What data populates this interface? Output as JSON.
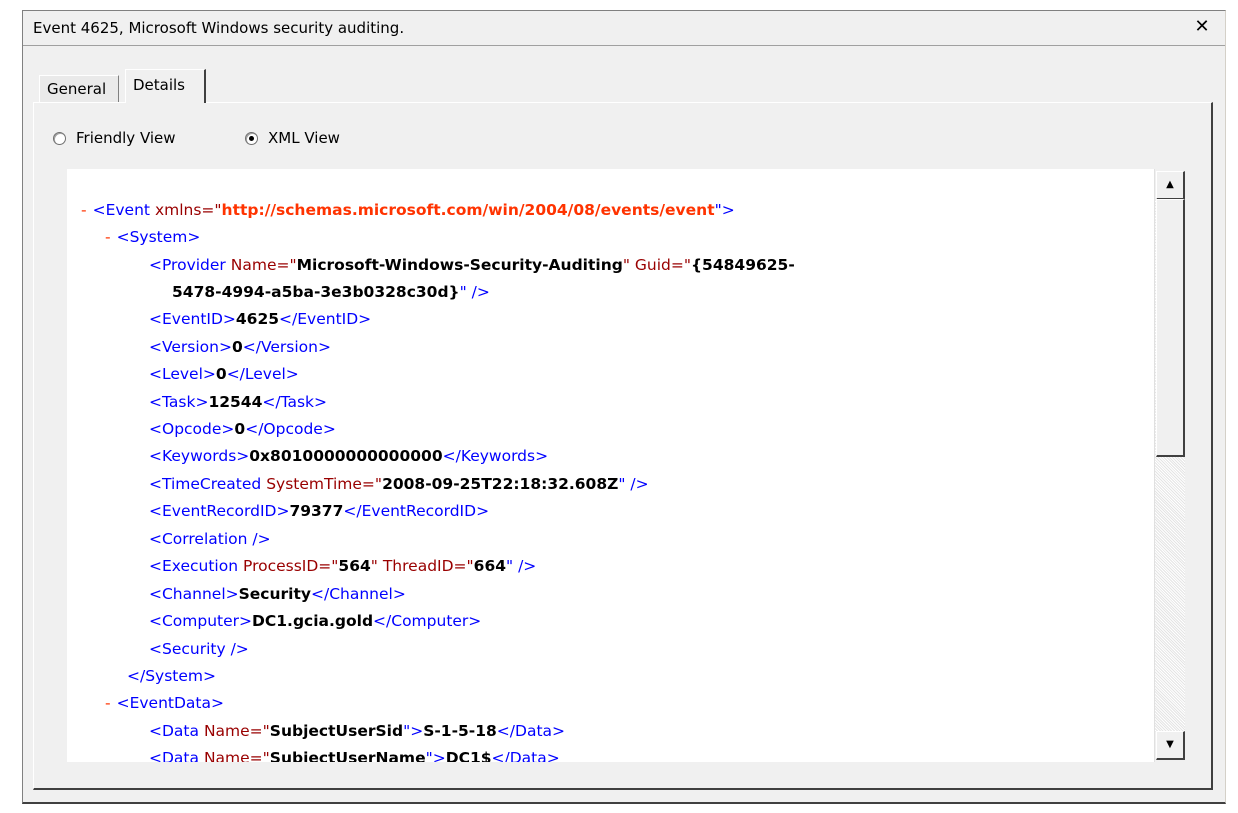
{
  "window": {
    "title": "Event 4625, Microsoft Windows security auditing.",
    "close_glyph": "✕"
  },
  "tabs": [
    {
      "label": "General",
      "active": false
    },
    {
      "label": "Details",
      "active": true
    }
  ],
  "view_options": {
    "friendly": {
      "label": "Friendly View",
      "checked": false
    },
    "xml": {
      "label": "XML View",
      "checked": true
    }
  },
  "xml": {
    "minus": "-",
    "event_open": "<Event",
    "xmlns_attr": "xmlns=\"",
    "xmlns_val": "http://schemas.microsoft.com/win/2004/08/events/event",
    "xmlns_close": "\">",
    "system_open": "<System>",
    "provider_open": "<Provider",
    "provider_name_attr": "Name=\"",
    "provider_name_val": "Microsoft-Windows-Security-Auditing",
    "provider_guid_attr": "\" Guid=\"",
    "provider_guid_val1": "{54849625-",
    "provider_guid_val2": "5478-4994-a5ba-3e3b0328c30d}",
    "provider_close": "\" />",
    "eventid_open": "<EventID>",
    "eventid_val": "4625",
    "eventid_close": "</EventID>",
    "version_open": "<Version>",
    "version_val": "0",
    "version_close": "</Version>",
    "level_open": "<Level>",
    "level_val": "0",
    "level_close": "</Level>",
    "task_open": "<Task>",
    "task_val": "12544",
    "task_close": "</Task>",
    "opcode_open": "<Opcode>",
    "opcode_val": "0",
    "opcode_close": "</Opcode>",
    "keywords_open": "<Keywords>",
    "keywords_val": "0x8010000000000000",
    "keywords_close": "</Keywords>",
    "timecreated_open": "<TimeCreated",
    "timecreated_attr": "SystemTime=\"",
    "timecreated_val": "2008-09-25T22:18:32.608Z",
    "timecreated_close": "\" />",
    "recordid_open": "<EventRecordID>",
    "recordid_val": "79377",
    "recordid_close": "</EventRecordID>",
    "correlation": "<Correlation />",
    "execution_open": "<Execution",
    "execution_pid_attr": "ProcessID=\"",
    "execution_pid_val": "564",
    "execution_tid_attr": "\" ThreadID=\"",
    "execution_tid_val": "664",
    "execution_close": "\" />",
    "channel_open": "<Channel>",
    "channel_val": "Security",
    "channel_close": "</Channel>",
    "computer_open": "<Computer>",
    "computer_val": "DC1.gcia.gold",
    "computer_close": "</Computer>",
    "security": "<Security />",
    "system_close": "</System>",
    "eventdata_open": "<EventData>",
    "data1_open": "<Data",
    "data1_attr": "Name=\"",
    "data1_name": "SubjectUserSid",
    "data1_mid": "\">",
    "data1_val": "S-1-5-18",
    "data1_close": "</Data>",
    "data2_open": "<Data",
    "data2_attr": "Name=\"",
    "data2_name": "SubjectUserName",
    "data2_mid": "\">",
    "data2_val": "DC1$",
    "data2_close": "</Data>"
  }
}
